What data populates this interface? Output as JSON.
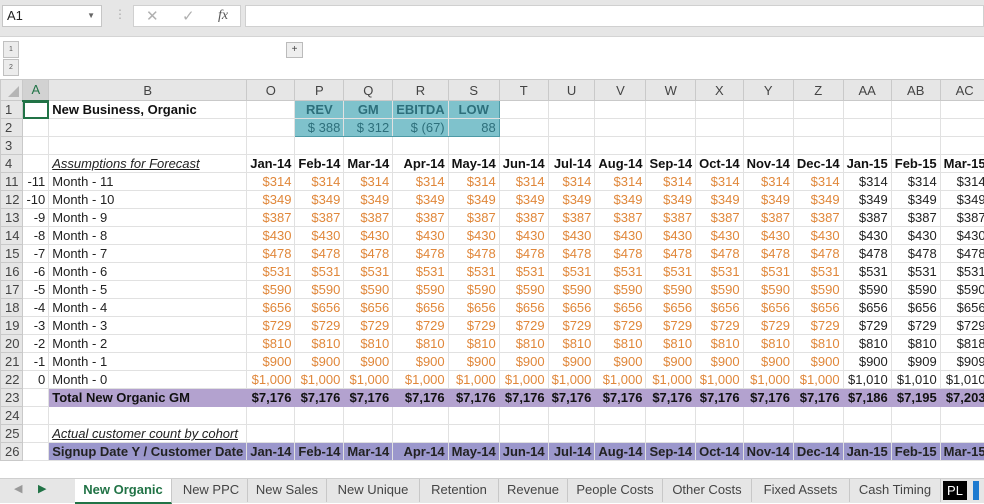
{
  "formula_bar": {
    "name_box": "A1",
    "cancel_icon": "✕",
    "enter_icon": "✓",
    "fx_label": "fx",
    "formula": ""
  },
  "outline": {
    "levels": [
      "1",
      "2"
    ],
    "expand": "+"
  },
  "columns": [
    "A",
    "B",
    "O",
    "P",
    "Q",
    "R",
    "S",
    "T",
    "U",
    "V",
    "W",
    "X",
    "Y",
    "Z",
    "AA",
    "AB",
    "AC"
  ],
  "sheet": {
    "title": "New Business, Organic",
    "kpi": {
      "headers": [
        "REV",
        "GM",
        "EBITDA",
        "LOW"
      ],
      "values": [
        "$  388",
        "$  312",
        "$  (67)",
        "88"
      ]
    },
    "assumptions_label": "Assumptions for Forecast",
    "months": [
      "Jan-14",
      "Feb-14",
      "Mar-14",
      "Apr-14",
      "May-14",
      "Jun-14",
      "Jul-14",
      "Aug-14",
      "Sep-14",
      "Oct-14",
      "Nov-14",
      "Dec-14",
      "Jan-15",
      "Feb-15",
      "Mar-15"
    ],
    "rows": [
      {
        "row": "11",
        "idx": "-11",
        "label": "Month - 11",
        "values": [
          "$314",
          "$314",
          "$314",
          "$314",
          "$314",
          "$314",
          "$314",
          "$314",
          "$314",
          "$314",
          "$314",
          "$314",
          "$314",
          "$314",
          "$314"
        ]
      },
      {
        "row": "12",
        "idx": "-10",
        "label": "Month - 10",
        "values": [
          "$349",
          "$349",
          "$349",
          "$349",
          "$349",
          "$349",
          "$349",
          "$349",
          "$349",
          "$349",
          "$349",
          "$349",
          "$349",
          "$349",
          "$349"
        ]
      },
      {
        "row": "13",
        "idx": "-9",
        "label": "Month - 9",
        "values": [
          "$387",
          "$387",
          "$387",
          "$387",
          "$387",
          "$387",
          "$387",
          "$387",
          "$387",
          "$387",
          "$387",
          "$387",
          "$387",
          "$387",
          "$387"
        ]
      },
      {
        "row": "14",
        "idx": "-8",
        "label": "Month - 8",
        "values": [
          "$430",
          "$430",
          "$430",
          "$430",
          "$430",
          "$430",
          "$430",
          "$430",
          "$430",
          "$430",
          "$430",
          "$430",
          "$430",
          "$430",
          "$430"
        ]
      },
      {
        "row": "15",
        "idx": "-7",
        "label": "Month - 7",
        "values": [
          "$478",
          "$478",
          "$478",
          "$478",
          "$478",
          "$478",
          "$478",
          "$478",
          "$478",
          "$478",
          "$478",
          "$478",
          "$478",
          "$478",
          "$478"
        ]
      },
      {
        "row": "16",
        "idx": "-6",
        "label": "Month - 6",
        "values": [
          "$531",
          "$531",
          "$531",
          "$531",
          "$531",
          "$531",
          "$531",
          "$531",
          "$531",
          "$531",
          "$531",
          "$531",
          "$531",
          "$531",
          "$531"
        ]
      },
      {
        "row": "17",
        "idx": "-5",
        "label": "Month - 5",
        "values": [
          "$590",
          "$590",
          "$590",
          "$590",
          "$590",
          "$590",
          "$590",
          "$590",
          "$590",
          "$590",
          "$590",
          "$590",
          "$590",
          "$590",
          "$590"
        ]
      },
      {
        "row": "18",
        "idx": "-4",
        "label": "Month - 4",
        "values": [
          "$656",
          "$656",
          "$656",
          "$656",
          "$656",
          "$656",
          "$656",
          "$656",
          "$656",
          "$656",
          "$656",
          "$656",
          "$656",
          "$656",
          "$656"
        ]
      },
      {
        "row": "19",
        "idx": "-3",
        "label": "Month - 3",
        "values": [
          "$729",
          "$729",
          "$729",
          "$729",
          "$729",
          "$729",
          "$729",
          "$729",
          "$729",
          "$729",
          "$729",
          "$729",
          "$729",
          "$729",
          "$729"
        ]
      },
      {
        "row": "20",
        "idx": "-2",
        "label": "Month - 2",
        "values": [
          "$810",
          "$810",
          "$810",
          "$810",
          "$810",
          "$810",
          "$810",
          "$810",
          "$810",
          "$810",
          "$810",
          "$810",
          "$810",
          "$810",
          "$818"
        ]
      },
      {
        "row": "21",
        "idx": "-1",
        "label": "Month - 1",
        "values": [
          "$900",
          "$900",
          "$900",
          "$900",
          "$900",
          "$900",
          "$900",
          "$900",
          "$900",
          "$900",
          "$900",
          "$900",
          "$900",
          "$909",
          "$909"
        ]
      },
      {
        "row": "22",
        "idx": "0",
        "label": "Month - 0",
        "values": [
          "$1,000",
          "$1,000",
          "$1,000",
          "$1,000",
          "$1,000",
          "$1,000",
          "$1,000",
          "$1,000",
          "$1,000",
          "$1,000",
          "$1,000",
          "$1,000",
          "$1,010",
          "$1,010",
          "$1,010"
        ]
      }
    ],
    "total": {
      "row": "23",
      "label": "Total New Organic GM",
      "values": [
        "$7,176",
        "$7,176",
        "$7,176",
        "$7,176",
        "$7,176",
        "$7,176",
        "$7,176",
        "$7,176",
        "$7,176",
        "$7,176",
        "$7,176",
        "$7,176",
        "$7,186",
        "$7,195",
        "$7,203"
      ]
    },
    "cohort_label": "Actual customer count by cohort",
    "row_numbers": [
      "1",
      "2",
      "3",
      "4",
      "24",
      "25",
      "26"
    ],
    "cohort_hdr_partial": "Signup Date Y / Customer Date"
  },
  "colors": {
    "forecast_orange": "#e0873a",
    "kpi_teal": "#7fc2cc",
    "total_purple": "#b3a2cf",
    "excel_green": "#217346"
  },
  "tabs": [
    {
      "label": "New Organic",
      "active": true
    },
    {
      "label": "New PPC"
    },
    {
      "label": "New Sales"
    },
    {
      "label": "New Unique"
    },
    {
      "label": "Retention"
    },
    {
      "label": "Revenue"
    },
    {
      "label": "People Costs"
    },
    {
      "label": "Other Costs"
    },
    {
      "label": "Fixed Assets"
    },
    {
      "label": "Cash Timing"
    },
    {
      "label": "PL"
    }
  ]
}
